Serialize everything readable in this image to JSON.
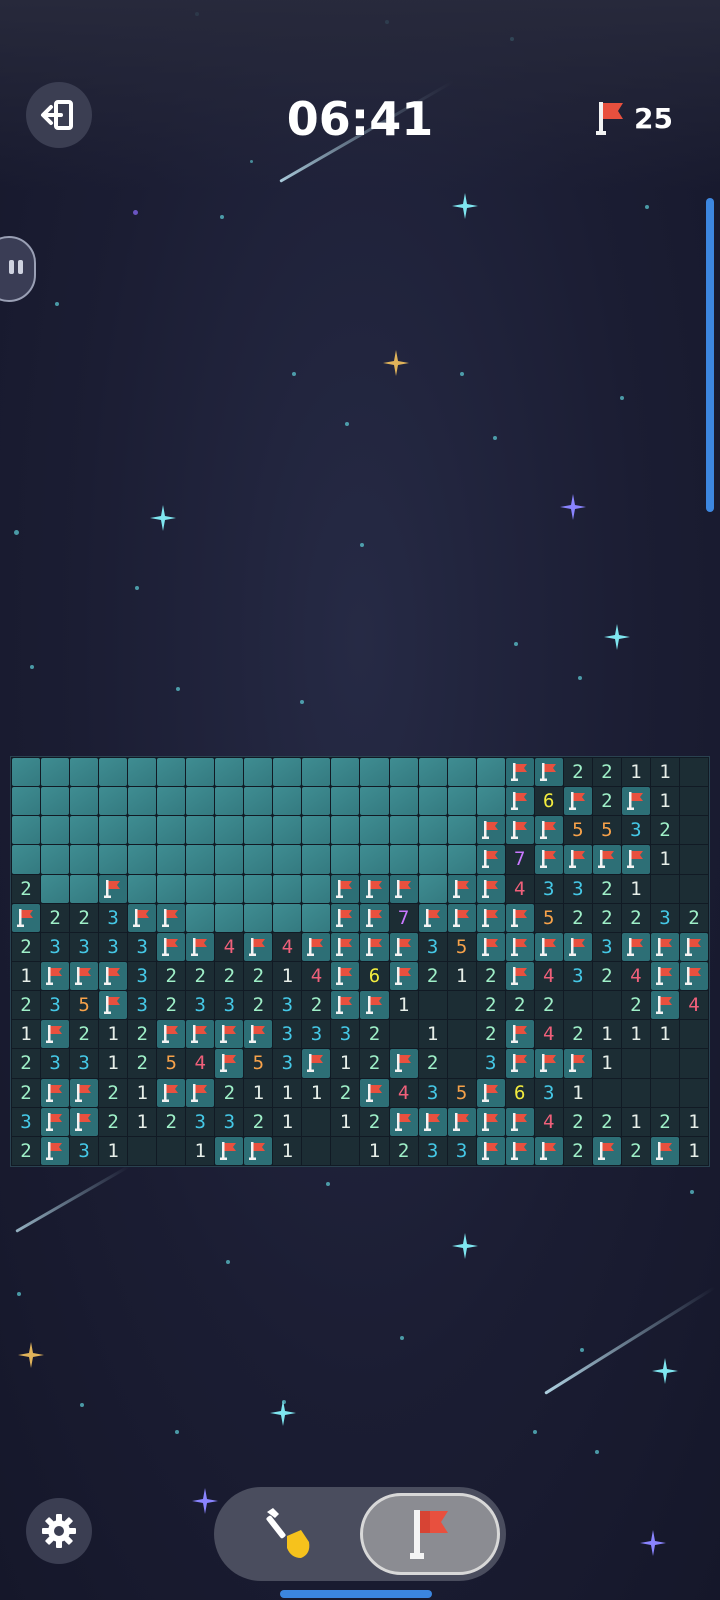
{
  "header": {
    "timer": "06:41",
    "flags_remaining": "25",
    "exit_icon": "exit-icon",
    "flag_icon": "flag-icon"
  },
  "board": {
    "columns": 24,
    "rows_count": 14,
    "legend": "H = hidden tile, F = flag, . = opened empty, 1-8 = number",
    "rows": [
      "HHHHHHHHHHHHHHHHHFF2211.",
      "HHHHHHHHHHHHHHHHHF6F2F1.",
      "HHHHHHHHHHHHHHHHFFF5532.",
      "HHHHHHHHHHHHHHHHF7FFFF1.",
      "2HHFHHHHHHHFFFHFF43321..",
      "F223FFHHHHHFF7FFFF522232",
      "23333FF4F4FFFF35FFFF3FFF",
      "1FFF3222214F6F212F4324FF",
      "235F3233232FF1..222..2F4",
      "1F212FFFF3332.1.2F42111.",
      "2331254F53F12F2.3FFF1...",
      "2FF21FF21112F435F631....",
      "3FF2123321.12FFFFF422121",
      "2F31..1FF1..1233FFF2F2F1"
    ]
  },
  "tools": {
    "dig_icon": "shovel-icon",
    "flag_icon": "flag-icon",
    "selected": "flag"
  },
  "settings_icon": "gear-icon",
  "colors": {
    "hidden_tile": "#3f8d92",
    "flag_tile": "#2d6f76",
    "open_tile": "#1c2d34",
    "flag_red": "#e8503e",
    "accent_blue": "#3d87e0"
  }
}
